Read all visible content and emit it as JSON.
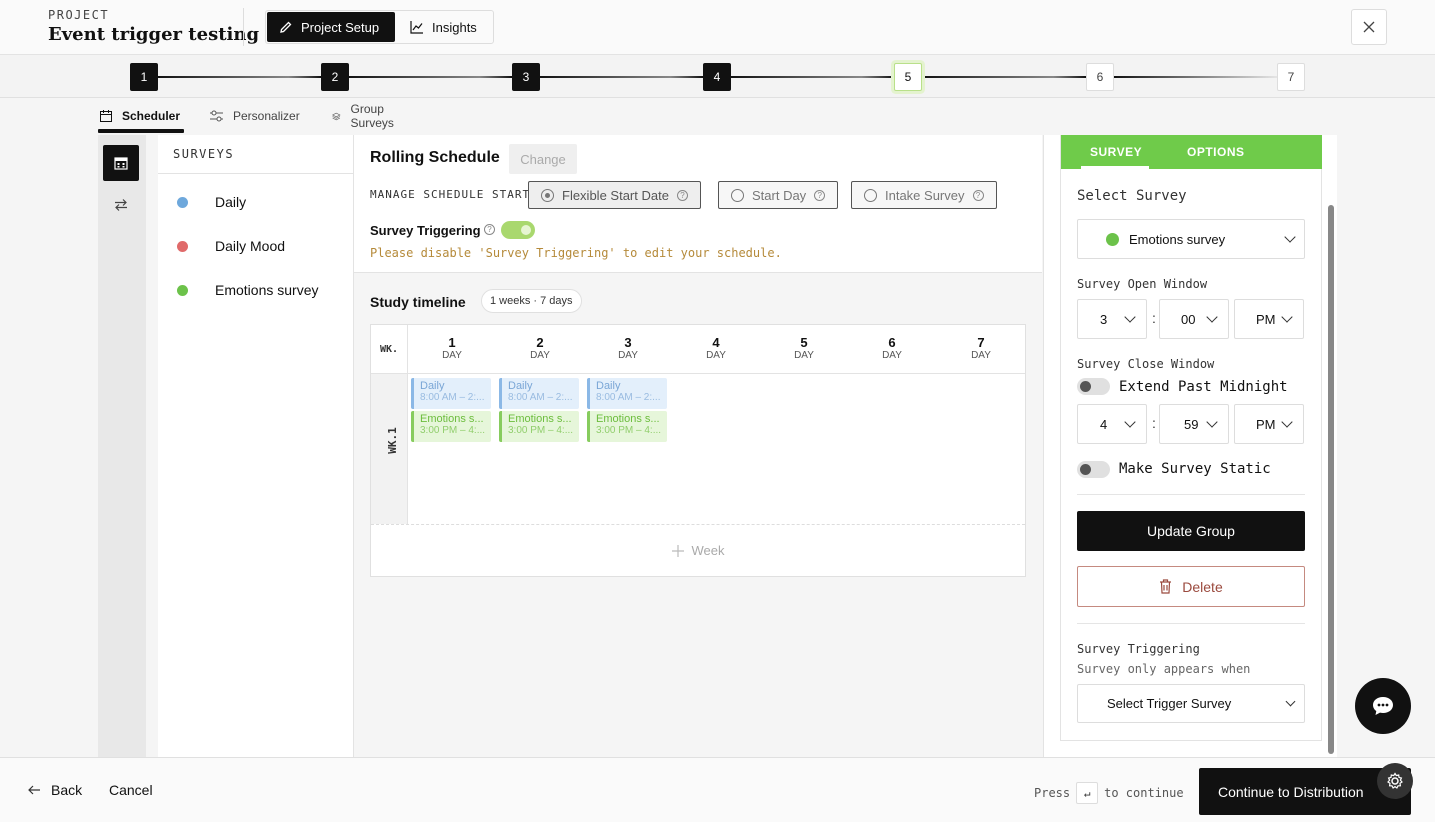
{
  "header": {
    "project_label": "PROJECT",
    "project_title": "Event trigger testing",
    "tabs": [
      {
        "label": "Project Setup"
      },
      {
        "label": "Insights"
      }
    ]
  },
  "stepper": {
    "steps": [
      {
        "label": "1",
        "state": "done"
      },
      {
        "label": "2",
        "state": "done"
      },
      {
        "label": "3",
        "state": "done"
      },
      {
        "label": "4",
        "state": "done"
      },
      {
        "label": "5",
        "state": "current"
      },
      {
        "label": "6",
        "state": "todo"
      },
      {
        "label": "7",
        "state": "todo"
      }
    ]
  },
  "subtabs": [
    {
      "label": "Scheduler"
    },
    {
      "label": "Personalizer"
    },
    {
      "label": "Group Surveys"
    }
  ],
  "surveys": {
    "heading": "SURVEYS",
    "items": [
      {
        "name": "Daily",
        "color": "#6ea8dc"
      },
      {
        "name": "Daily Mood",
        "color": "#e06a6a"
      },
      {
        "name": "Emotions survey",
        "color": "#6cc24a"
      }
    ]
  },
  "schedule": {
    "title": "Rolling Schedule",
    "change_label": "Change",
    "manage_label": "MANAGE SCHEDULE START",
    "options": [
      {
        "label": "Flexible Start Date"
      },
      {
        "label": "Start Day"
      },
      {
        "label": "Intake Survey"
      }
    ],
    "triggering_label": "Survey Triggering",
    "warning": "Please disable 'Survey Triggering' to edit your schedule."
  },
  "timeline": {
    "title": "Study timeline",
    "badge": "1 weeks · 7 days",
    "wk_header": "WK.",
    "week_label": "WK.1",
    "days": [
      {
        "num": "1",
        "label": "DAY"
      },
      {
        "num": "2",
        "label": "DAY"
      },
      {
        "num": "3",
        "label": "DAY"
      },
      {
        "num": "4",
        "label": "DAY"
      },
      {
        "num": "5",
        "label": "DAY"
      },
      {
        "num": "6",
        "label": "DAY"
      },
      {
        "num": "7",
        "label": "DAY"
      }
    ],
    "events": [
      {
        "name": "Daily",
        "time": "8:00 AM – 2:..."
      },
      {
        "name": "Emotions s...",
        "time": "3:00 PM – 4:..."
      }
    ],
    "add_week": "Week"
  },
  "right_panel": {
    "tabs": [
      {
        "label": "SURVEY"
      },
      {
        "label": "OPTIONS"
      }
    ],
    "select_survey_label": "Select Survey",
    "selected_survey": "Emotions survey",
    "selected_color": "#6cc24a",
    "open_window_label": "Survey Open Window",
    "open": {
      "hour": "3",
      "minute": "00",
      "ampm": "PM"
    },
    "close_window_label": "Survey Close Window",
    "extend_label": "Extend Past Midnight",
    "close": {
      "hour": "4",
      "minute": "59",
      "ampm": "PM"
    },
    "static_label": "Make Survey Static",
    "update_label": "Update Group",
    "delete_label": "Delete",
    "triggering_label": "Survey Triggering",
    "triggering_sub": "Survey only appears when",
    "trigger_select": "Select Trigger Survey"
  },
  "footer": {
    "back": "Back",
    "cancel": "Cancel",
    "press": "Press",
    "key": "↵",
    "to_continue": "to continue",
    "continue": "Continue to Distribution"
  },
  "colors": {
    "accent_green": "#6fcb4a",
    "primary": "#111111"
  }
}
